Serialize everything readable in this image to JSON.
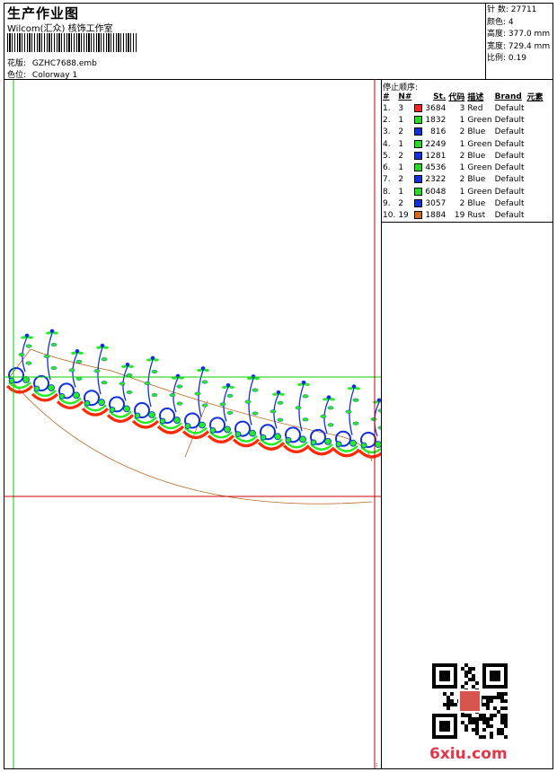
{
  "header": {
    "title": "生产作业图",
    "studio": "Wilcom(汇众) 核饰工作室",
    "design_label": "花版:",
    "design_file": "GZHC7688.emb",
    "colorway_label": "色位:",
    "colorway": "Colorway 1"
  },
  "stats": [
    {
      "label": "针 数:",
      "value": "27711"
    },
    {
      "label": "颜色:",
      "value": "4"
    },
    {
      "label": "高度:",
      "value": "377.0 mm"
    },
    {
      "label": "宽度:",
      "value": "729.4 mm"
    },
    {
      "label": "比例:",
      "value": "0.19"
    }
  ],
  "stop_sequence": {
    "title": "停止顺序:",
    "columns": [
      "#",
      "N#",
      "St.",
      "代码",
      "描述",
      "Brand",
      "元素"
    ],
    "rows": [
      {
        "idx": "1.",
        "n": "3",
        "color": "#ff2020",
        "st": "3684",
        "code": "3",
        "desc": "Red",
        "brand": "Default"
      },
      {
        "idx": "2.",
        "n": "1",
        "color": "#22dd22",
        "st": "1832",
        "code": "1",
        "desc": "Green",
        "brand": "Default"
      },
      {
        "idx": "3.",
        "n": "2",
        "color": "#1030dd",
        "st": "816",
        "code": "2",
        "desc": "Blue",
        "brand": "Default"
      },
      {
        "idx": "4.",
        "n": "1",
        "color": "#22dd22",
        "st": "2249",
        "code": "1",
        "desc": "Green",
        "brand": "Default"
      },
      {
        "idx": "5.",
        "n": "2",
        "color": "#1030dd",
        "st": "1281",
        "code": "2",
        "desc": "Blue",
        "brand": "Default"
      },
      {
        "idx": "6.",
        "n": "1",
        "color": "#22dd22",
        "st": "4536",
        "code": "1",
        "desc": "Green",
        "brand": "Default"
      },
      {
        "idx": "7.",
        "n": "2",
        "color": "#1030dd",
        "st": "2322",
        "code": "2",
        "desc": "Blue",
        "brand": "Default"
      },
      {
        "idx": "8.",
        "n": "1",
        "color": "#22dd22",
        "st": "6048",
        "code": "1",
        "desc": "Green",
        "brand": "Default"
      },
      {
        "idx": "9.",
        "n": "2",
        "color": "#1030dd",
        "st": "3057",
        "code": "2",
        "desc": "Blue",
        "brand": "Default"
      },
      {
        "idx": "10.",
        "n": "19",
        "color": "#d2691e",
        "st": "1884",
        "code": "19",
        "desc": "Rust",
        "brand": "Default"
      }
    ]
  },
  "colors": {
    "guide_green": "#00cc00",
    "guide_red": "#cc0000",
    "outline": "#b5651d",
    "stitch_red": "#ff2a00",
    "stitch_green": "#22ee22",
    "stitch_blue": "#1030dd",
    "watermark": "#e0384a"
  },
  "icons": {
    "qr": "qr-code-icon",
    "seal": "seal-stamp-icon"
  },
  "watermark": "6xiu.com"
}
